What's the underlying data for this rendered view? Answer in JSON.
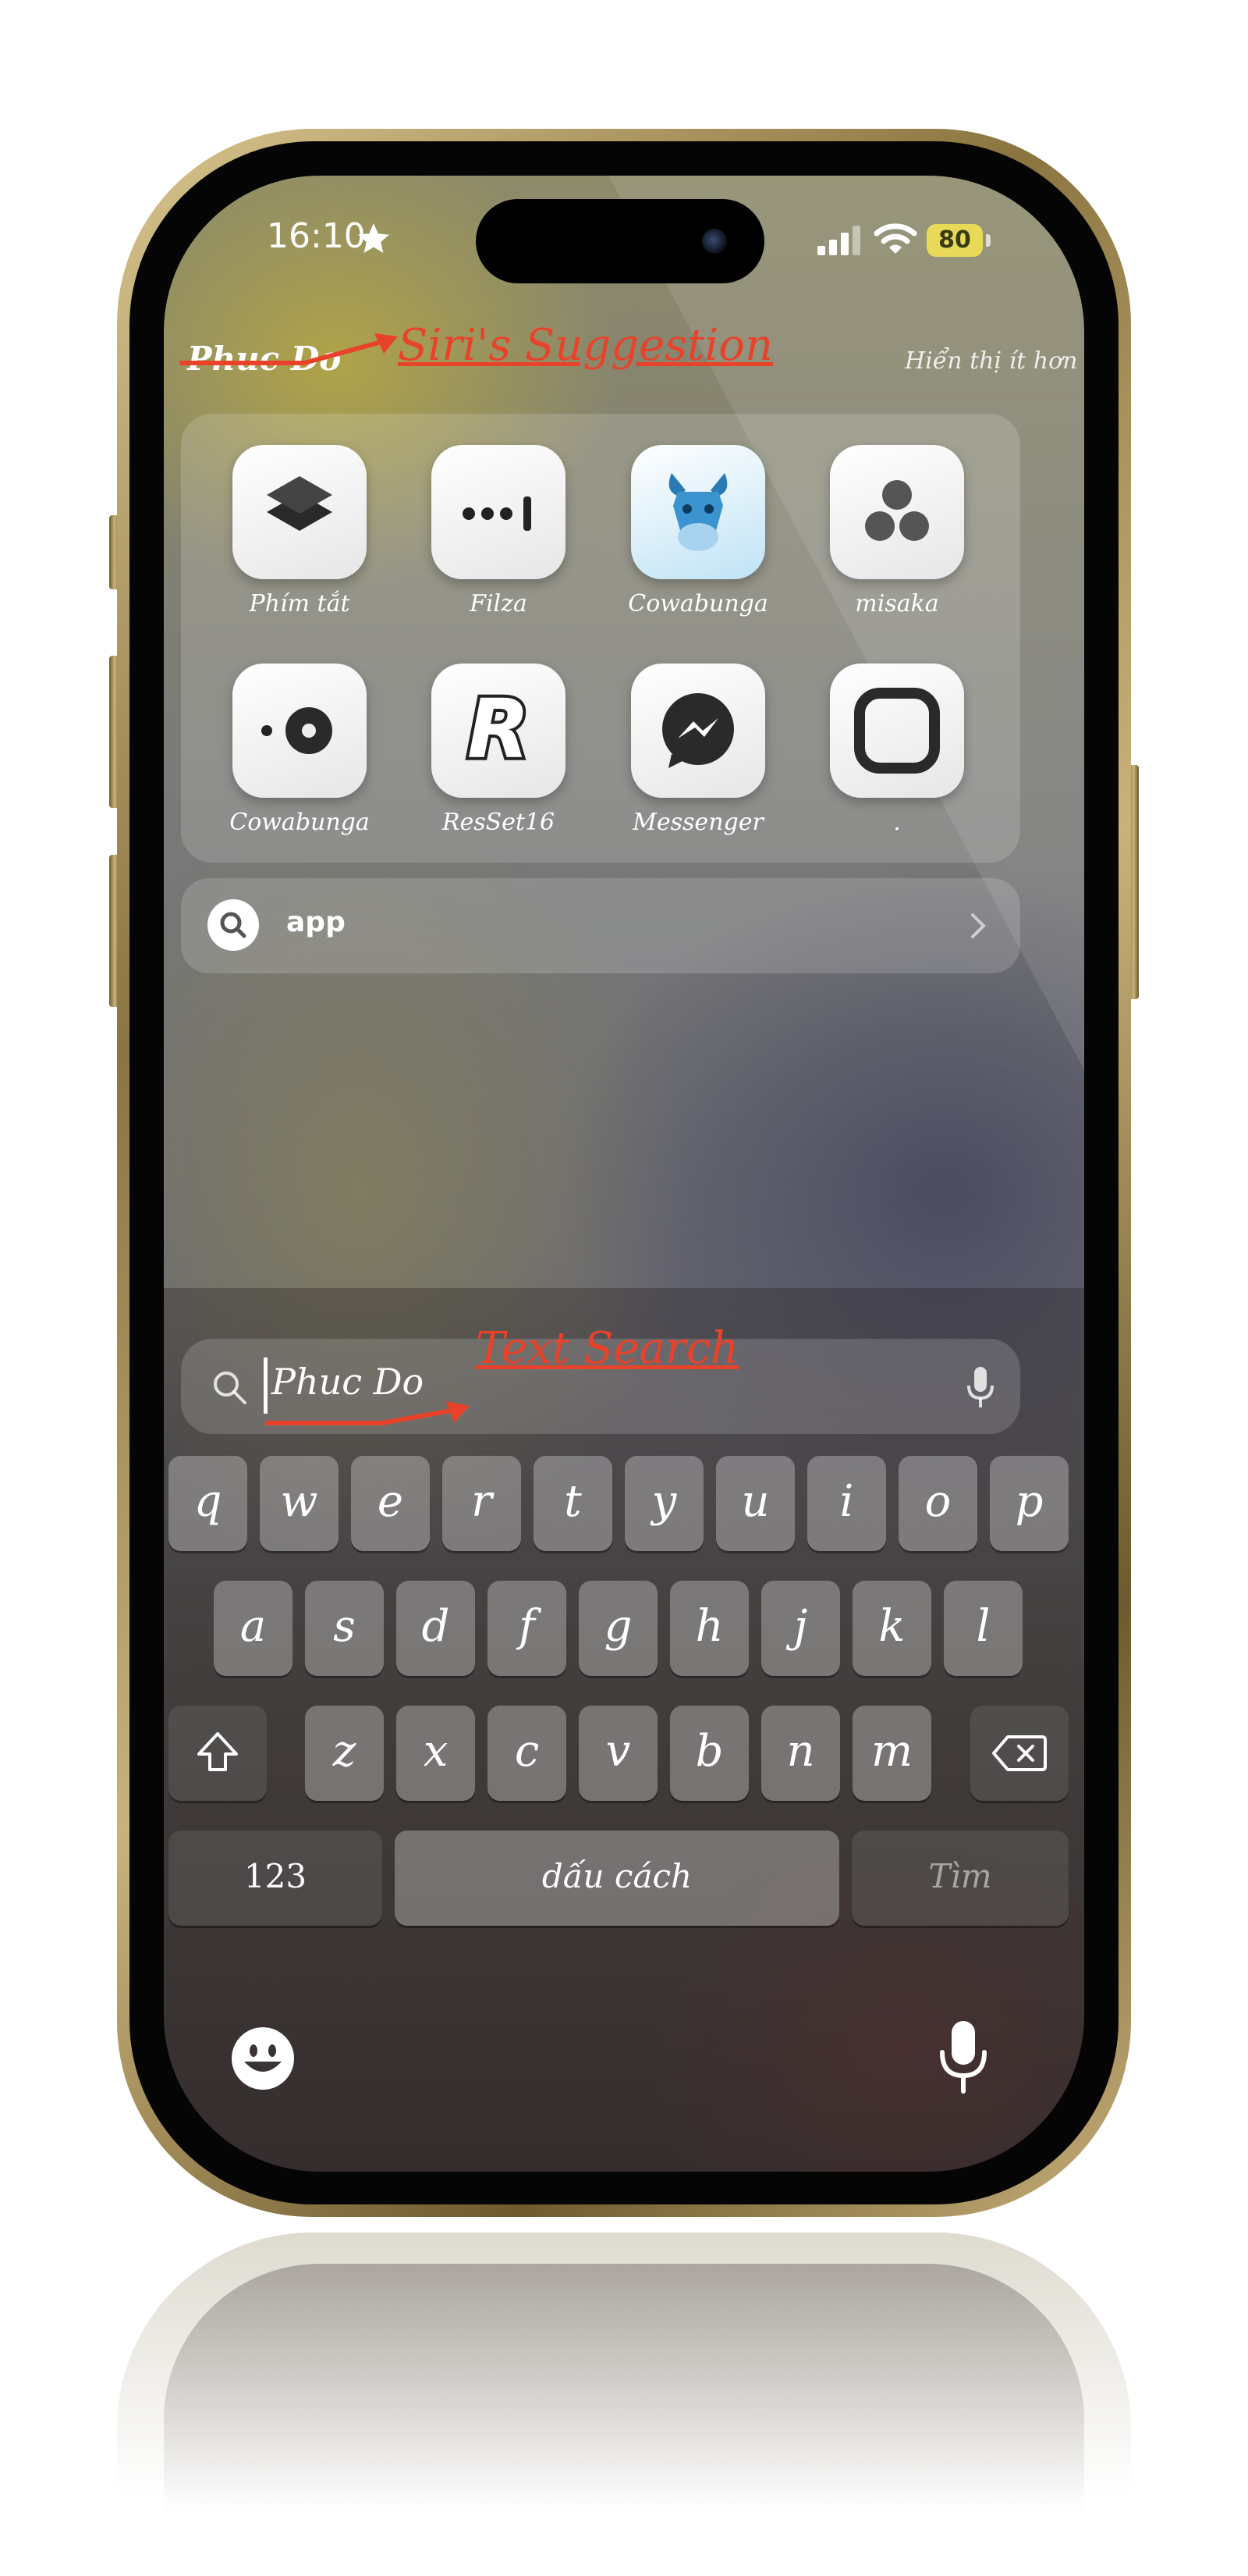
{
  "status_bar": {
    "time": "16:10",
    "battery": "80"
  },
  "header": {
    "title": "Phuc Do",
    "show_less": "Hiển thị ít hơn",
    "siri_annotation": "Siri's Suggestion"
  },
  "suggested_apps": [
    {
      "label": "Phím tắt",
      "icon": "shortcuts-icon"
    },
    {
      "label": "Filza",
      "icon": "filza-icon"
    },
    {
      "label": "Cowabunga",
      "icon": "cowabunga-icon"
    },
    {
      "label": "misaka",
      "icon": "misaka-icon"
    },
    {
      "label": "Cowabunga",
      "icon": "cowabunga-record-icon"
    },
    {
      "label": "ResSet16",
      "icon": "resset16-icon"
    },
    {
      "label": "Messenger",
      "icon": "messenger-icon"
    },
    {
      "label": ".",
      "icon": "blank-square-icon"
    }
  ],
  "search_suggestion": {
    "label": "app"
  },
  "search": {
    "value": "Phuc Do",
    "annotation": "Text Search"
  },
  "keyboard": {
    "row1": [
      "q",
      "w",
      "e",
      "r",
      "t",
      "y",
      "u",
      "i",
      "o",
      "p"
    ],
    "row2": [
      "a",
      "s",
      "d",
      "f",
      "g",
      "h",
      "j",
      "k",
      "l"
    ],
    "row3": [
      "z",
      "x",
      "c",
      "v",
      "b",
      "n",
      "m"
    ],
    "numbers_key": "123",
    "space_key": "dấu cách",
    "search_key": "Tìm"
  },
  "colors": {
    "annotation": "#e8432a",
    "battery": "#e8da58",
    "frame": "#c8b07a"
  }
}
